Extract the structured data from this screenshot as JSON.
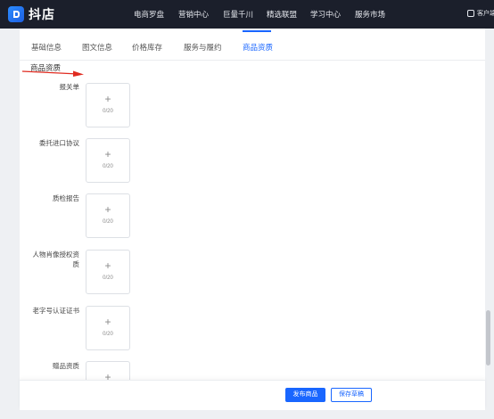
{
  "app": {
    "brand": "抖店"
  },
  "topnav": [
    "电商罗盘",
    "营销中心",
    "巨量千川",
    "精选联盟",
    "学习中心",
    "服务市场"
  ],
  "top_right": {
    "label": "客户端"
  },
  "tabs": [
    {
      "label": "基础信息",
      "active": false
    },
    {
      "label": "图文信息",
      "active": false
    },
    {
      "label": "价格库存",
      "active": false
    },
    {
      "label": "服务与履约",
      "active": false
    },
    {
      "label": "商品资质",
      "active": true
    }
  ],
  "section": {
    "title": "商品资质"
  },
  "fields": [
    {
      "label": "报关单",
      "plus": "+",
      "count": "0/20"
    },
    {
      "label": "委托进口协议",
      "plus": "+",
      "count": "0/20"
    },
    {
      "label": "质检报告",
      "plus": "+",
      "count": "0/20"
    },
    {
      "label_line1": "人物肖像授权资",
      "label_line2": "质",
      "plus": "+",
      "count": "0/20"
    },
    {
      "label": "老字号认证证书",
      "plus": "+",
      "count": "0/20"
    },
    {
      "label": "赠品资质",
      "plus": "+",
      "count": ""
    }
  ],
  "footer": {
    "publish_label": "发布商品",
    "draft_label": "保存草稿"
  },
  "colors": {
    "accent": "#1966ff",
    "topbar": "#1b1f2b",
    "annotation_arrow": "#e02b20"
  }
}
